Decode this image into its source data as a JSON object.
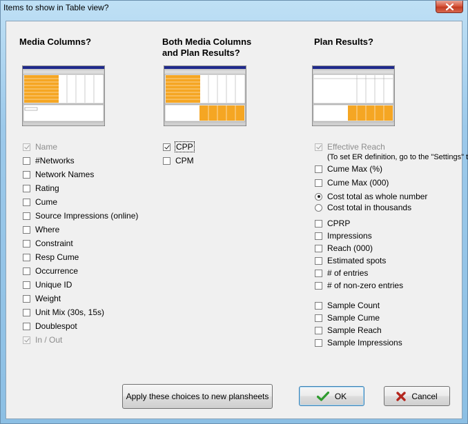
{
  "window": {
    "title": "Items to show in Table view?"
  },
  "columns": {
    "media": {
      "heading_line1": "Media Columns?",
      "items": [
        {
          "label": "Name",
          "checked": true,
          "disabled": true
        },
        {
          "label": "#Networks",
          "checked": false,
          "disabled": false
        },
        {
          "label": "Network Names",
          "checked": false,
          "disabled": false
        },
        {
          "label": "Rating",
          "checked": false,
          "disabled": false
        },
        {
          "label": "Cume",
          "checked": false,
          "disabled": false
        },
        {
          "label": "Source Impressions (online)",
          "checked": false,
          "disabled": false
        },
        {
          "label": "Where",
          "checked": false,
          "disabled": false
        },
        {
          "label": "Constraint",
          "checked": false,
          "disabled": false
        },
        {
          "label": "Resp Cume",
          "checked": false,
          "disabled": false
        },
        {
          "label": "Occurrence",
          "checked": false,
          "disabled": false
        },
        {
          "label": "Unique ID",
          "checked": false,
          "disabled": false
        },
        {
          "label": "Weight",
          "checked": false,
          "disabled": false
        },
        {
          "label": "Unit Mix (30s, 15s)",
          "checked": false,
          "disabled": false
        },
        {
          "label": "Doublespot",
          "checked": false,
          "disabled": false
        },
        {
          "label": "In / Out",
          "checked": true,
          "disabled": true
        }
      ]
    },
    "both": {
      "heading_line1": "Both Media Columns",
      "heading_line2": "and Plan Results?",
      "items": [
        {
          "label": "CPP",
          "checked": true,
          "disabled": false,
          "focused": true
        },
        {
          "label": "CPM",
          "checked": false,
          "disabled": false
        }
      ]
    },
    "plan": {
      "heading_line1": "Plan Results?",
      "effective_reach": {
        "label": "Effective Reach",
        "checked": true,
        "disabled": true
      },
      "note": "(To set ER definition, go to the \"Settings\" tab)",
      "cume_items": [
        {
          "label": "Cume Max (%)",
          "checked": false
        },
        {
          "label": "Cume Max (000)",
          "checked": false
        }
      ],
      "cost_radios": [
        {
          "label": "Cost total as whole number",
          "selected": true
        },
        {
          "label": "Cost total in thousands",
          "selected": false
        }
      ],
      "result_items": [
        {
          "label": "CPRP",
          "checked": false
        },
        {
          "label": "Impressions",
          "checked": false
        },
        {
          "label": "Reach (000)",
          "checked": false
        },
        {
          "label": "Estimated spots",
          "checked": false
        },
        {
          "label": "# of entries",
          "checked": false
        },
        {
          "label": "# of non-zero entries",
          "checked": false
        }
      ],
      "sample_items": [
        {
          "label": "Sample Count",
          "checked": false
        },
        {
          "label": "Sample Cume",
          "checked": false
        },
        {
          "label": "Sample Reach",
          "checked": false
        },
        {
          "label": "Sample Impressions",
          "checked": false
        }
      ]
    }
  },
  "buttons": {
    "apply_label": "Apply these choices to new plansheets",
    "ok_label": "OK",
    "cancel_label": "Cancel"
  },
  "icons": {
    "ok": "checkmark-icon",
    "cancel": "x-cross-icon",
    "close": "close-icon"
  },
  "colors": {
    "accent_orange": "#f5a623",
    "ok_green": "#2e9b2e",
    "cancel_red": "#b3261e"
  }
}
